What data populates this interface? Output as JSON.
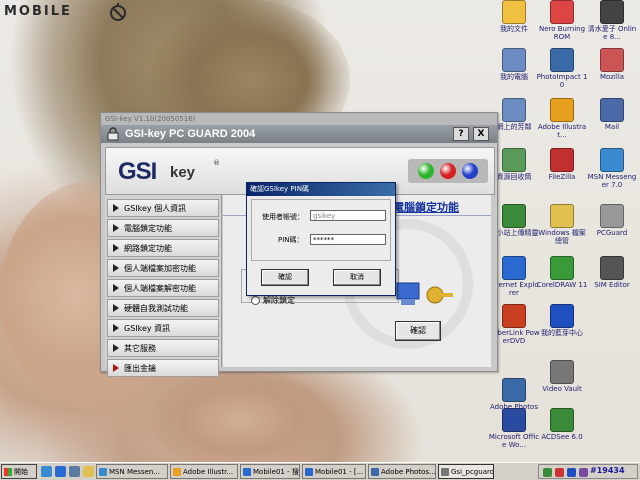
{
  "brand": {
    "text": "MOBILE"
  },
  "desktop_icons": [
    {
      "label": "我的文件",
      "color": "#f0c040"
    },
    {
      "label": "Nero Burning ROM",
      "color": "#d44"
    },
    {
      "label": "清水愛子 Online 8...",
      "color": "#444"
    },
    {
      "label": "我的電腦",
      "color": "#6a8cc0"
    },
    {
      "label": "PhotoImpact 10",
      "color": "#3a6aa8"
    },
    {
      "label": "Mozilla",
      "color": "#c55"
    },
    {
      "label": "網上的芳鄰",
      "color": "#6a8cc0"
    },
    {
      "label": "Adobe Illustrat...",
      "color": "#e8a020"
    },
    {
      "label": "Mail",
      "color": "#4a6aa8"
    },
    {
      "label": "資源回收筒",
      "color": "#5a9a5a"
    },
    {
      "label": "FileZilla",
      "color": "#c03030"
    },
    {
      "label": "MSN Messenger 7.0",
      "color": "#3a8ad0"
    },
    {
      "label": "台小站上傳精靈",
      "color": "#3a8a3a"
    },
    {
      "label": "Windows 檔案總管",
      "color": "#e0c050"
    },
    {
      "label": "PCGuard",
      "color": "#999"
    },
    {
      "label": "Internet Explorer",
      "color": "#2a6ad0"
    },
    {
      "label": "CorelDRAW 11",
      "color": "#3a9a3a"
    },
    {
      "label": "SIM Editor",
      "color": "#555"
    },
    {
      "label": "CyberLink PowerDVD",
      "color": "#c84020"
    },
    {
      "label": "我的藍芽中心",
      "color": "#2050c0"
    },
    {
      "label": "Adobe Photoshop CS",
      "color": "#3a6aa8"
    },
    {
      "label": "Video Vault",
      "color": "#777"
    },
    {
      "label": "Microsoft Office Wo...",
      "color": "#2a4aa0"
    },
    {
      "label": "ACDSee 6.0",
      "color": "#3a8a3a"
    }
  ],
  "app": {
    "ghost_title": "GSI-key V1.1b(20050516)",
    "title": "GSI-key PC GUARD 2004",
    "help_button": "?",
    "close_button": "X",
    "logo_gs": "GSI",
    "logo_key": "key",
    "logo_reg": "®",
    "lights": [
      {
        "name": "green-light",
        "color": "#2db52d"
      },
      {
        "name": "red-light",
        "color": "#d42020"
      },
      {
        "name": "blue-light",
        "color": "#2040c8"
      }
    ],
    "sidebar": [
      {
        "label": "GSIkey 個人資訊",
        "red": false
      },
      {
        "label": "電腦鎖定功能",
        "red": false
      },
      {
        "label": "網路鎖定功能",
        "red": false
      },
      {
        "label": "個人端檔案加密功能",
        "red": false
      },
      {
        "label": "個人端檔案解密功能",
        "red": false
      },
      {
        "label": "硬體自我測試功能",
        "red": false
      },
      {
        "label": "GSIkey 資訊",
        "red": false
      },
      {
        "label": "其它服務",
        "red": false
      },
      {
        "label": "匯出金鑰",
        "red": true
      }
    ],
    "content": {
      "title": "電腦鎖定功能",
      "radio_unlock": "解除鎖定",
      "ok_button": "確認"
    }
  },
  "dialog": {
    "title": "確認GSIkey PIN碼",
    "user_label": "使用者帳號：",
    "user_value": "gsikey",
    "pin_label": "PIN碼：",
    "pin_value": "******",
    "ok_button": "確認",
    "cancel_button": "取消"
  },
  "taskbar": {
    "start_label": "開始",
    "tasks": [
      {
        "label": "MSN Messen...",
        "color": "#3a8ad0",
        "active": false
      },
      {
        "label": "Adobe Illustr...",
        "color": "#e8a020",
        "active": false
      },
      {
        "label": "Mobile01 - 搜...",
        "color": "#2a6ad0",
        "active": false
      },
      {
        "label": "Mobile01 - [...",
        "color": "#2a6ad0",
        "active": false
      },
      {
        "label": "Adobe Photos...",
        "color": "#3a6aa8",
        "active": false
      },
      {
        "label": "Gsi_pcguard",
        "color": "#777",
        "active": true
      }
    ],
    "tray_text": "#19434"
  }
}
